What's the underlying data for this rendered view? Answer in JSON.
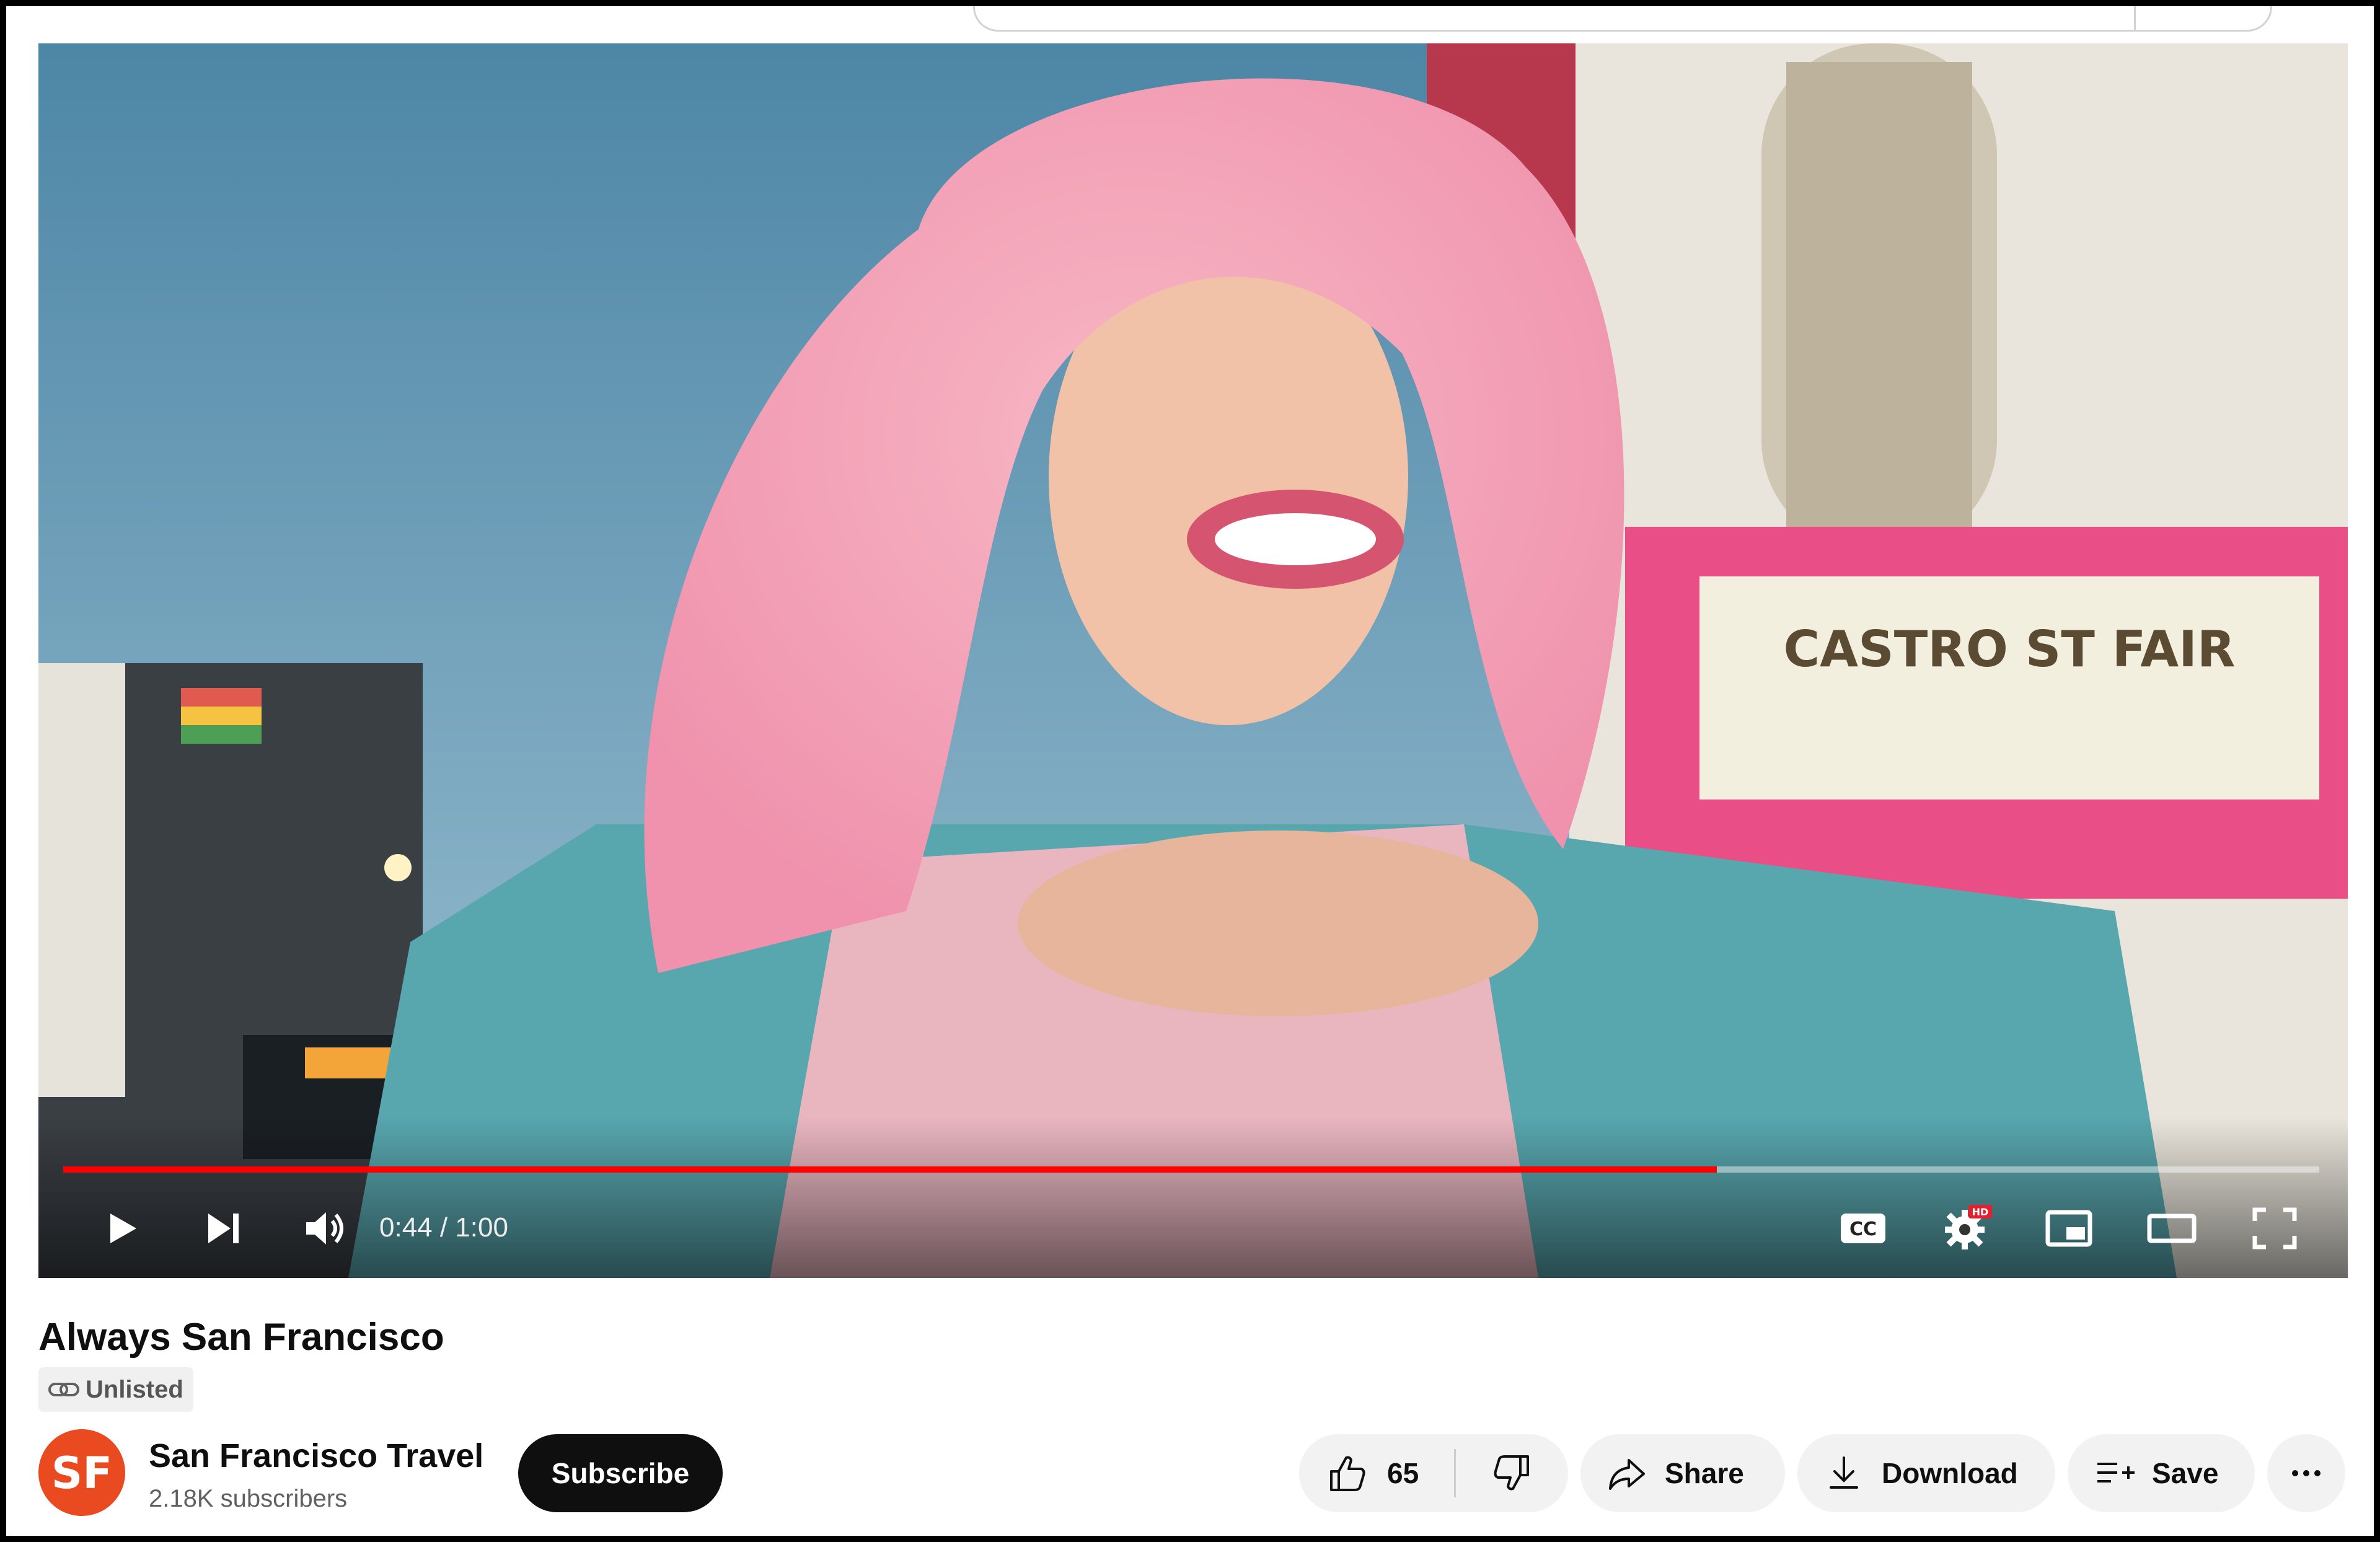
{
  "video": {
    "current_time": "0:44",
    "duration": "1:00",
    "time_display": "0:44 / 1:00",
    "progress_fraction": 0.733,
    "hd_badge": "HD",
    "marquee_text": "CASTRO ST FAIR"
  },
  "controls": {
    "play_icon": "play-icon",
    "next_icon": "next-icon",
    "volume_icon": "volume-icon",
    "captions_icon": "cc-icon",
    "settings_icon": "gear-icon",
    "miniplayer_icon": "miniplayer-icon",
    "theater_icon": "theater-icon",
    "fullscreen_icon": "fullscreen-icon"
  },
  "title": "Always San Francisco",
  "visibility": "Unlisted",
  "channel": {
    "name": "San Francisco Travel",
    "subscribers": "2.18K subscribers",
    "avatar_text": "SF",
    "avatar_color": "#e94a1f"
  },
  "actions": {
    "subscribe": "Subscribe",
    "likes": "65",
    "share": "Share",
    "download": "Download",
    "save": "Save"
  },
  "colors": {
    "progress": "#ff0000",
    "subscribe_bg": "#0f0f0f",
    "pill_bg": "#f2f2f2"
  }
}
